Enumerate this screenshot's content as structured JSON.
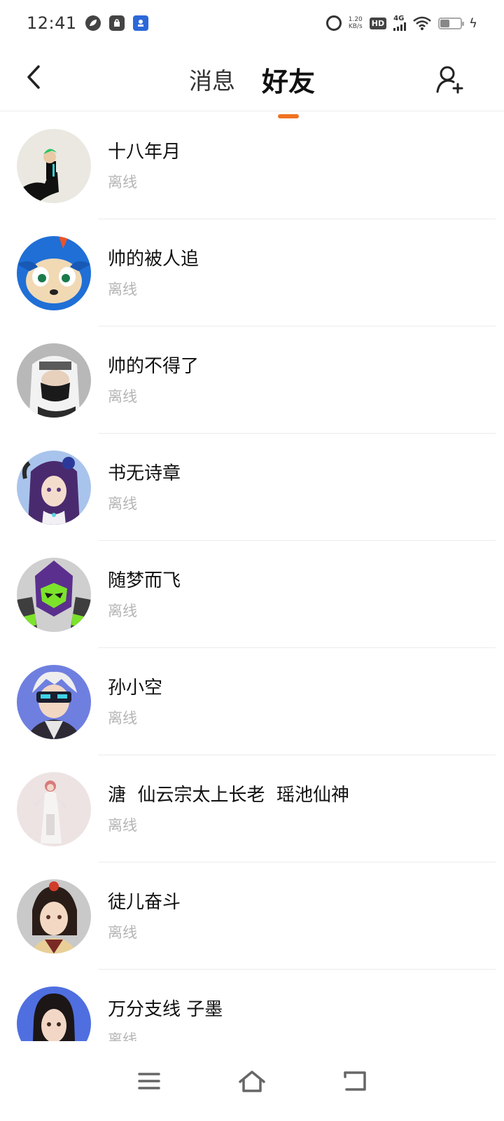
{
  "status_bar": {
    "time": "12:41",
    "net_speed_value": "1.20",
    "net_speed_unit": "KB/s",
    "hd": "HD",
    "network": "4G"
  },
  "header": {
    "tabs": [
      {
        "label": "消息",
        "active": false
      },
      {
        "label": "好友",
        "active": true
      }
    ],
    "accent_color": "#f07222"
  },
  "friends": [
    {
      "name": "十八年月",
      "status": "离线",
      "avatar": "green-hair-character-avatar"
    },
    {
      "name": "帅的被人追",
      "status": "离线",
      "avatar": "blue-cartoon-character-avatar"
    },
    {
      "name": "帅的不得了",
      "status": "离线",
      "avatar": "masked-ninja-avatar"
    },
    {
      "name": "书无诗章",
      "status": "离线",
      "avatar": "purple-hair-girl-avatar"
    },
    {
      "name": "随梦而飞",
      "status": "离线",
      "avatar": "purple-green-mecha-avatar"
    },
    {
      "name": "孙小空",
      "status": "离线",
      "avatar": "white-hair-visor-avatar"
    },
    {
      "name": "溏  仙云宗太上长老  瑶池仙神",
      "status": "离线",
      "avatar": "white-dress-figure-avatar"
    },
    {
      "name": "徒儿奋斗",
      "status": "离线",
      "avatar": "black-hair-warrior-avatar"
    },
    {
      "name": "万分支线 子墨",
      "status": "离线",
      "avatar": "long-hair-man-avatar"
    }
  ],
  "nav": {
    "menu": "menu-icon",
    "home": "home-icon",
    "back": "back-icon"
  }
}
